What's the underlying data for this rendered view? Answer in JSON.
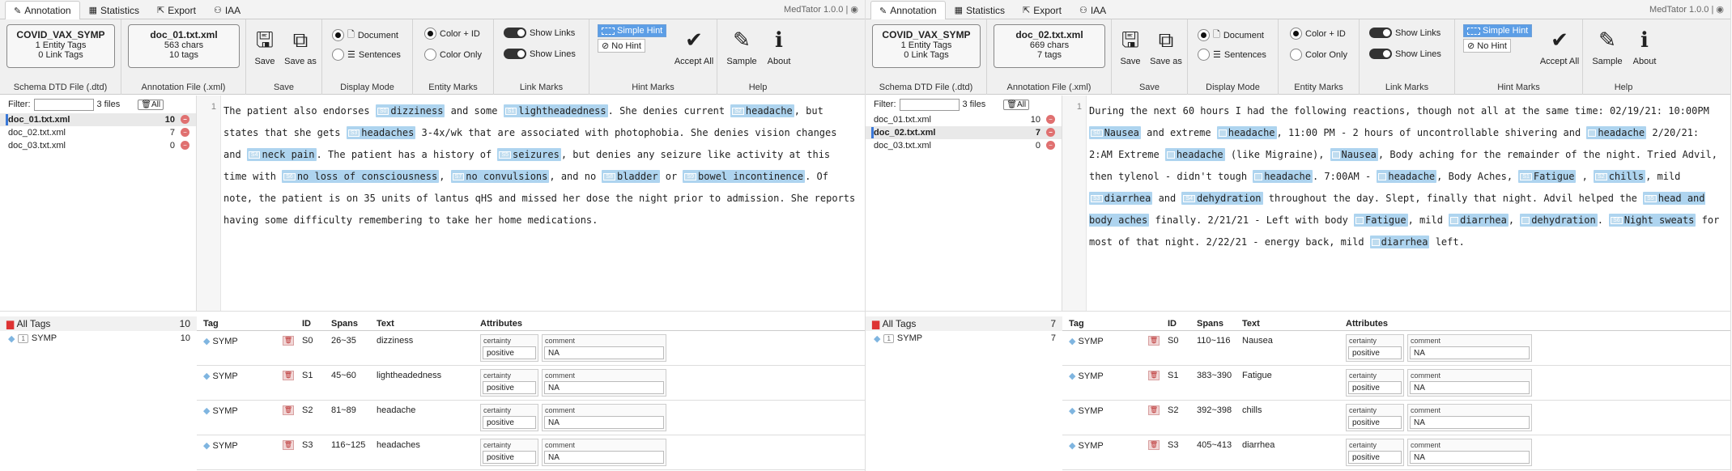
{
  "app": {
    "version": "MedTator 1.0.0 |"
  },
  "tabs": [
    "Annotation",
    "Statistics",
    "Export",
    "IAA"
  ],
  "ribbon": {
    "schema_label": "Schema DTD File (.dtd)",
    "annotation_label": "Annotation File (.xml)",
    "save": "Save",
    "save_as": "Save as",
    "save_label": "Save",
    "display_mode": {
      "document": "Document",
      "sentences": "Sentences",
      "label": "Display Mode"
    },
    "entity_marks": {
      "color_id": "Color + ID",
      "color_only": "Color Only",
      "label": "Entity Marks"
    },
    "link_marks": {
      "show_links": "Show Links",
      "show_lines": "Show Lines",
      "label": "Link Marks"
    },
    "hint_marks": {
      "simple_hint": "Simple Hint",
      "no_hint": "No Hint",
      "accept_all": "Accept All",
      "label": "Hint Marks"
    },
    "help": {
      "sample": "Sample",
      "about": "About",
      "label": "Help"
    }
  },
  "filter": {
    "label": "Filter:",
    "count": "3 files",
    "all": "All"
  },
  "tag_table": {
    "headers": [
      "Tag",
      "ID",
      "Spans",
      "Text",
      "Attributes"
    ],
    "all_tags": "All Tags",
    "tag_key": "1",
    "tag_name": "SYMP",
    "certainty_label": "certainty",
    "comment_label": "comment"
  },
  "colors": {
    "accent": "#3a78d8",
    "mark": "#aed4ef"
  },
  "left": {
    "schema": {
      "name": "COVID_VAX_SYMP",
      "l1": "1 Entity Tags",
      "l2": "0 Link Tags"
    },
    "doc": {
      "name": "doc_01.txt.xml",
      "l1": "563 chars",
      "l2": "10 tags"
    },
    "files": [
      {
        "name": "doc_01.txt.xml",
        "count": "10"
      },
      {
        "name": "doc_02.txt.xml",
        "count": "7"
      },
      {
        "name": "doc_03.txt.xml",
        "count": "0"
      }
    ],
    "selected": 0,
    "all_tags_count": "10",
    "symp_count": "10",
    "line_no": "1",
    "text": [
      {
        "t": "The patient also endorses "
      },
      {
        "m": "dizziness",
        "id": "S0"
      },
      {
        "t": " and some "
      },
      {
        "m": "lightheadedness",
        "id": "S1"
      },
      {
        "t": ". She denies current "
      },
      {
        "m": "headache",
        "id": "S2"
      },
      {
        "t": ", but states that she gets "
      },
      {
        "m": "headaches",
        "id": "S3"
      },
      {
        "t": " 3-4x/wk that are associated with photophobia. She denies vision changes and "
      },
      {
        "m": "neck pain",
        "id": "S4"
      },
      {
        "t": ". The patient has a history of "
      },
      {
        "m": "seizures",
        "id": "S5"
      },
      {
        "t": ", but denies any seizure like activity at this time with "
      },
      {
        "m": "no loss of consciousness",
        "id": "S6"
      },
      {
        "t": ", "
      },
      {
        "m": "no convulsions",
        "id": "S7"
      },
      {
        "t": ", and no "
      },
      {
        "m": "bladder",
        "id": "S8"
      },
      {
        "t": " or "
      },
      {
        "m": "bowel incontinence",
        "id": "S9"
      },
      {
        "t": ". Of note, the patient is on 35 units of lantus qHS and missed her dose the night prior to admission. She reports having some difficulty remembering to take her home medications."
      }
    ],
    "rows": [
      {
        "id": "S0",
        "spans": "26~35",
        "text": "dizziness",
        "certainty": "positive",
        "comment": "NA"
      },
      {
        "id": "S1",
        "spans": "45~60",
        "text": "lightheadedness",
        "certainty": "positive",
        "comment": "NA"
      },
      {
        "id": "S2",
        "spans": "81~89",
        "text": "headache",
        "certainty": "positive",
        "comment": "NA"
      },
      {
        "id": "S3",
        "spans": "116~125",
        "text": "headaches",
        "certainty": "positive",
        "comment": "NA"
      }
    ]
  },
  "right": {
    "schema": {
      "name": "COVID_VAX_SYMP",
      "l1": "1 Entity Tags",
      "l2": "0 Link Tags"
    },
    "doc": {
      "name": "doc_02.txt.xml",
      "l1": "669 chars",
      "l2": "7 tags"
    },
    "files": [
      {
        "name": "doc_01.txt.xml",
        "count": "10"
      },
      {
        "name": "doc_02.txt.xml",
        "count": "7"
      },
      {
        "name": "doc_03.txt.xml",
        "count": "0"
      }
    ],
    "selected": 1,
    "all_tags_count": "7",
    "symp_count": "7",
    "line_no": "1",
    "text": [
      {
        "t": "During the next 60 hours I had the following reactions, though not all at the same time: 02/19/21:  10:00PM "
      },
      {
        "m": "Nausea",
        "id": "S0"
      },
      {
        "t": " and extreme "
      },
      {
        "m": "headache",
        "id": ""
      },
      {
        "t": ", 11:00 PM - 2 hours of uncontrollable shivering and "
      },
      {
        "m": "headache",
        "id": ""
      },
      {
        "t": " 2/20/21:  2:AM Extreme "
      },
      {
        "m": "headache",
        "id": ""
      },
      {
        "t": " (like Migraine), "
      },
      {
        "m": "Nausea",
        "id": ""
      },
      {
        "t": ", Body aching for the remainder of the night. Tried Advil, then tylenol - didn't tough "
      },
      {
        "m": "headache",
        "id": ""
      },
      {
        "t": ". 7:00AM - "
      },
      {
        "m": "headache",
        "id": ""
      },
      {
        "t": ", Body Aches, "
      },
      {
        "m": "Fatigue",
        "id": "S1"
      },
      {
        "t": " , "
      },
      {
        "m": "chills",
        "id": "S2"
      },
      {
        "t": ", mild "
      },
      {
        "m": "diarrhea",
        "id": "S3"
      },
      {
        "t": " and "
      },
      {
        "m": "dehydration",
        "id": "S4"
      },
      {
        "t": " throughout the day.  Slept, finally that night.  Advil helped the "
      },
      {
        "m": "head and body aches",
        "id": "S5"
      },
      {
        "t": " finally.  2/21/21 - Left with body "
      },
      {
        "m": "Fatigue",
        "id": ""
      },
      {
        "t": ", mild "
      },
      {
        "m": "diarrhea",
        "id": ""
      },
      {
        "t": ", "
      },
      {
        "m": "dehydration",
        "id": ""
      },
      {
        "t": ".  "
      },
      {
        "m": "Night sweats",
        "id": "S6"
      },
      {
        "t": " for most of that night. 2/22/21 - energy back, mild "
      },
      {
        "m": "diarrhea",
        "id": ""
      },
      {
        "t": " left."
      }
    ],
    "rows": [
      {
        "id": "S0",
        "spans": "110~116",
        "text": "Nausea",
        "certainty": "positive",
        "comment": "NA"
      },
      {
        "id": "S1",
        "spans": "383~390",
        "text": "Fatigue",
        "certainty": "positive",
        "comment": "NA"
      },
      {
        "id": "S2",
        "spans": "392~398",
        "text": "chills",
        "certainty": "positive",
        "comment": "NA"
      },
      {
        "id": "S3",
        "spans": "405~413",
        "text": "diarrhea",
        "certainty": "positive",
        "comment": "NA"
      }
    ]
  }
}
